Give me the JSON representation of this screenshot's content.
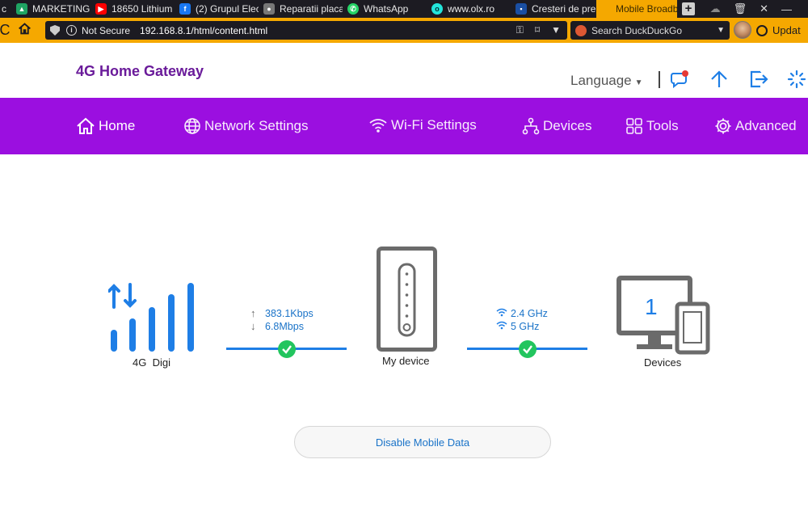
{
  "browser": {
    "tabs": [
      {
        "title": "c",
        "fav": "",
        "color": "#1c1b22"
      },
      {
        "title": "MARKETING -",
        "fav": "drive-icon",
        "color": "#1fa463"
      },
      {
        "title": "18650 Lithium",
        "fav": "youtube-icon",
        "color": "#ff0000"
      },
      {
        "title": "(2) Grupul Elec",
        "fav": "facebook-icon",
        "color": "#1877f2"
      },
      {
        "title": "Reparatii placa",
        "fav": "user-icon",
        "color": "#777777"
      },
      {
        "title": "WhatsApp",
        "fav": "whatsapp-icon",
        "color": "#25d366"
      },
      {
        "title": "www.olx.ro",
        "fav": "olx-icon",
        "color": "#23e5db"
      },
      {
        "title": "Cresteri de pre",
        "fav": "doc-icon",
        "color": "#1a4fa3"
      },
      {
        "title": "Mobile Broadb",
        "fav": "",
        "color": "#f5a800"
      }
    ],
    "not_secure": "Not Secure",
    "url": "192.168.8.1/html/content.html",
    "search_placeholder": "Search DuckDuckGo",
    "update_label": "Updat"
  },
  "header": {
    "brand": "4G Home Gateway",
    "language": "Language"
  },
  "nav": [
    {
      "label": "Home",
      "icon": "home-icon"
    },
    {
      "label": "Network Settings",
      "icon": "globe-icon"
    },
    {
      "label": "Wi-Fi Settings",
      "icon": "wifi-icon"
    },
    {
      "label": "Devices",
      "icon": "network-icon"
    },
    {
      "label": "Tools",
      "icon": "tools-icon"
    },
    {
      "label": "Advanced",
      "icon": "gear-icon"
    }
  ],
  "status": {
    "network_type": "4G",
    "operator": "Digi",
    "upload_rate": "383.1Kbps",
    "download_rate": "6.8Mbps",
    "device_label": "My device",
    "band_24": "2.4 GHz",
    "band_5": "5 GHz",
    "devices_count": "1",
    "devices_label": "Devices"
  },
  "actions": {
    "disable_mobile_data": "Disable Mobile Data"
  },
  "colors": {
    "brand": "#6a1b9a",
    "nav_bg": "#9b0fe0",
    "accent_blue": "#1e7ee6",
    "ok_green": "#22c55e"
  }
}
